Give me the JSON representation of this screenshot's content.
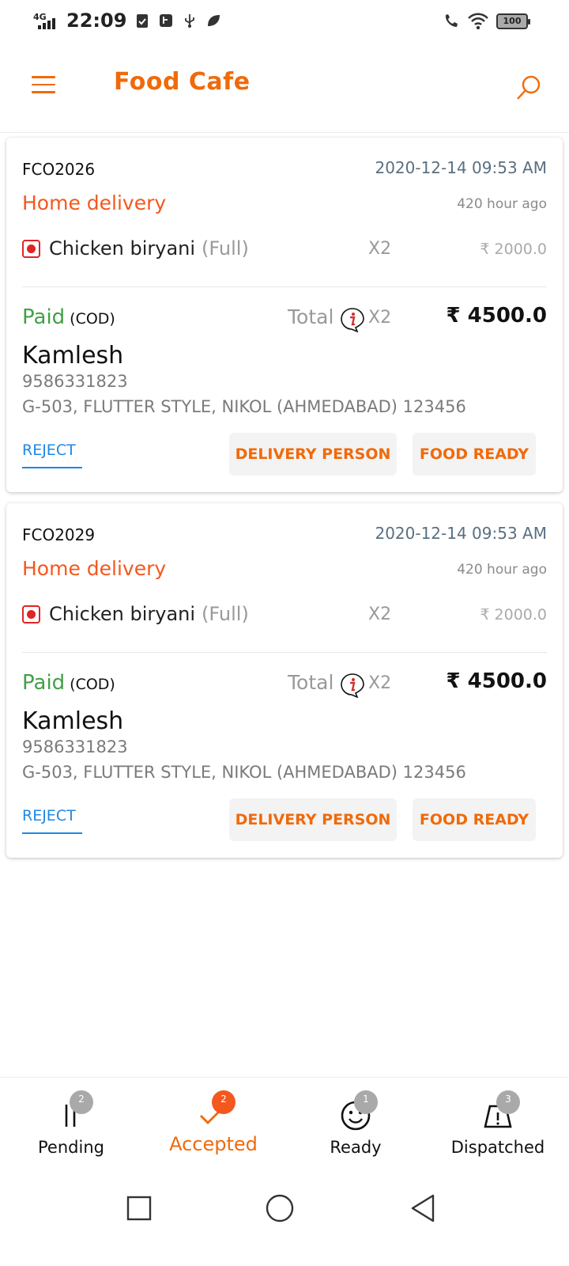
{
  "status_bar": {
    "network": "4G",
    "time": "22:09",
    "battery": "100"
  },
  "app_bar": {
    "title": "Food Cafe"
  },
  "orders": [
    {
      "id": "FCO2026",
      "datetime": "2020-12-14 09:53 AM",
      "type": "Home delivery",
      "ago": "420 hour ago",
      "item_name": "Chicken biryani",
      "item_variant": "(Full)",
      "item_qty": "X2",
      "item_price": "₹ 2000.0",
      "payment_status": "Paid",
      "payment_mode": "(COD)",
      "total_label": "Total",
      "total_qty": "X2",
      "total_amount": "₹ 4500.0",
      "customer_name": "Kamlesh",
      "customer_phone": "9586331823",
      "customer_address": "G-503, FLUTTER STYLE, NIKOL (AHMEDABAD) 123456",
      "reject_label": "REJECT",
      "delivery_label": "DELIVERY PERSON",
      "ready_label": "FOOD READY"
    },
    {
      "id": "FCO2029",
      "datetime": "2020-12-14 09:53 AM",
      "type": "Home delivery",
      "ago": "420 hour ago",
      "item_name": "Chicken biryani",
      "item_variant": "(Full)",
      "item_qty": "X2",
      "item_price": "₹ 2000.0",
      "payment_status": "Paid",
      "payment_mode": "(COD)",
      "total_label": "Total",
      "total_qty": "X2",
      "total_amount": "₹ 4500.0",
      "customer_name": "Kamlesh",
      "customer_phone": "9586331823",
      "customer_address": "G-503, FLUTTER STYLE, NIKOL (AHMEDABAD) 123456",
      "reject_label": "REJECT",
      "delivery_label": "DELIVERY PERSON",
      "ready_label": "FOOD READY"
    }
  ],
  "bottom_nav": [
    {
      "label": "Pending",
      "badge": "2",
      "icon": "pause-icon"
    },
    {
      "label": "Accepted",
      "badge": "2",
      "icon": "check-icon",
      "active": true
    },
    {
      "label": "Ready",
      "badge": "1",
      "icon": "smiley-icon"
    },
    {
      "label": "Dispatched",
      "badge": "3",
      "icon": "box-icon"
    }
  ],
  "colors": {
    "accent": "#f06a0a",
    "delivery_type": "#f4581e",
    "paid": "#43a047",
    "link": "#1e88e5",
    "veg_mark": "#e02424"
  }
}
